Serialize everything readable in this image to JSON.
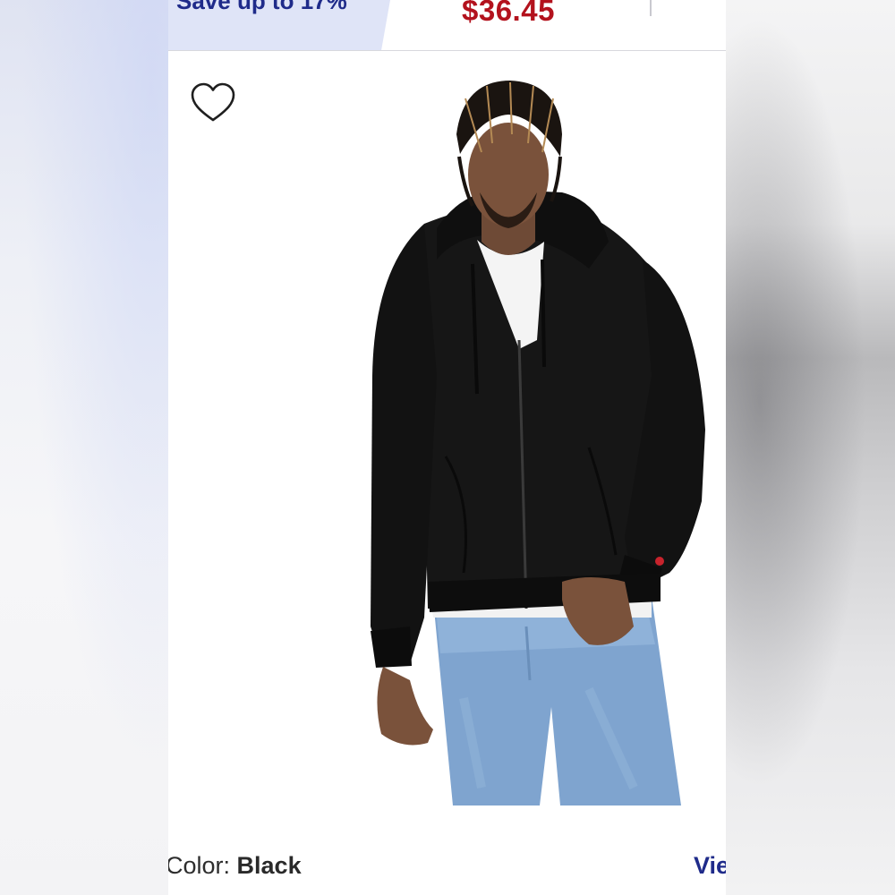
{
  "banner": {
    "save_text": "Save up to 17%",
    "price": "$36.45"
  },
  "product": {
    "color_label": "Color:",
    "color_value": "Black",
    "view_link": "Vie"
  },
  "icons": {
    "favorite": "heart-outline-icon"
  },
  "colors": {
    "accent_blue": "#1f2b8a",
    "price_red": "#b3121d",
    "save_bg": "#dfe4f7"
  }
}
